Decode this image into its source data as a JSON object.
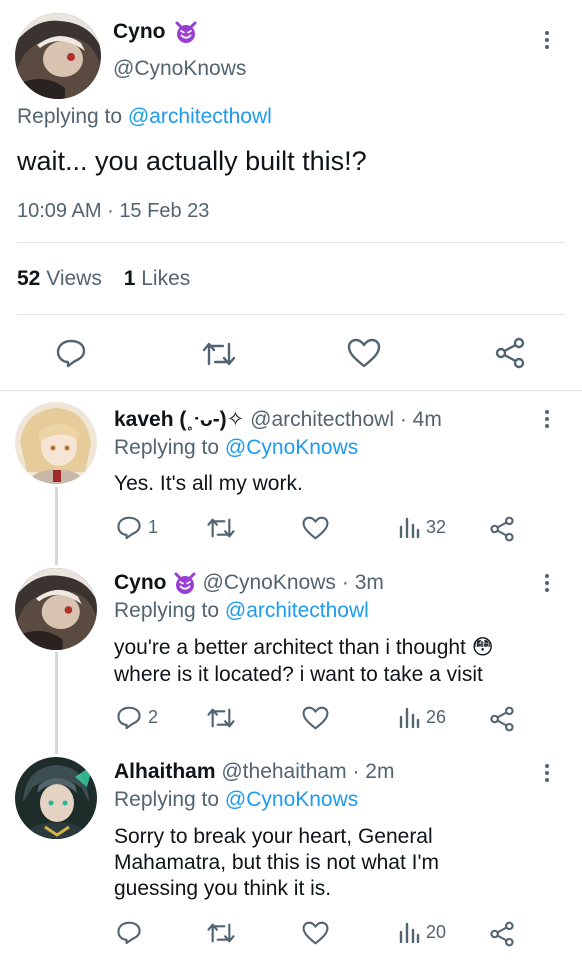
{
  "main_tweet": {
    "name": "Cyno",
    "emoji": "😈",
    "handle": "@CynoKnows",
    "replying_prefix": "Replying to",
    "replying_handle": "@architecthowl",
    "text": "wait... you actually built this!?",
    "time": "10:09 AM",
    "dot": "·",
    "date": "15 Feb 23",
    "views_count": "52",
    "views_label": "Views",
    "likes_count": "1",
    "likes_label": "Likes"
  },
  "replies": [
    {
      "name": "kaveh (˳ᐧᴗ-)✧",
      "handle": "@architecthowl",
      "time": "· 4m",
      "replying_prefix": "Replying to",
      "replying_handle": "@CynoKnows",
      "text": "Yes. It's all my work.",
      "reply_count": "1",
      "view_count": "32"
    },
    {
      "name": "Cyno",
      "emoji": "😈",
      "handle": "@CynoKnows",
      "time": "· 3m",
      "replying_prefix": "Replying to",
      "replying_handle": "@architecthowl",
      "text_line1": "you're a better architect than i thought 😳",
      "text_line2": "where is it located? i want to take a visit",
      "reply_count": "2",
      "view_count": "26"
    },
    {
      "name": "Alhaitham",
      "handle": "@thehaitham",
      "time": "· 2m",
      "replying_prefix": "Replying to",
      "replying_handle": "@CynoKnows",
      "text_line1": "Sorry to break your heart, General",
      "text_line2": "Mahamatra, but this is not what I'm",
      "text_line3": "guessing you think it is.",
      "view_count": "20"
    }
  ],
  "colors": {
    "accent": "#1d9bf0",
    "muted": "#536471",
    "text": "#0f1419",
    "emoji_purple": "#9b3fd3"
  }
}
